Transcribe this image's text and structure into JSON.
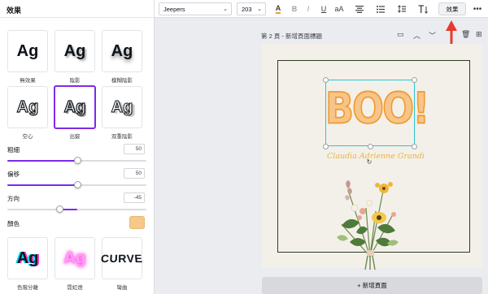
{
  "panel": {
    "title": "效果",
    "effects": [
      {
        "sample": "Ag",
        "label": "無效果"
      },
      {
        "sample": "Ag",
        "label": "陰影"
      },
      {
        "sample": "Ag",
        "label": "模糊陰影"
      },
      {
        "sample": "Ag",
        "label": "空心"
      },
      {
        "sample": "Ag",
        "label": "出竅"
      },
      {
        "sample": "Ag",
        "label": "双重陰影"
      },
      {
        "sample": "Ag",
        "label": "色階分離"
      },
      {
        "sample": "Ag",
        "label": "霓虹燈"
      },
      {
        "sample": "CURVE",
        "label": "彎曲"
      }
    ],
    "selected_effect": "出竅",
    "thickness": {
      "label": "粗細",
      "value": "50",
      "level": 0.5
    },
    "offset": {
      "label": "偏移",
      "value": "50",
      "level": 0.5
    },
    "direction": {
      "label": "方向",
      "value": "-45",
      "level": 0.375
    },
    "color": {
      "label": "顏色",
      "swatch": "#f6c98a"
    }
  },
  "toolbar": {
    "font": "Jeepers",
    "size": "203",
    "text_color_glyph": "A",
    "bold": "B",
    "italic": "I",
    "underline": "U",
    "case": "aA",
    "effects_label": "效果",
    "more": "•••"
  },
  "page": {
    "header": "第 2 頁 - 新增頁面標題",
    "add_page": "+ 新增頁面"
  },
  "canvas": {
    "boo_text": "BOO!",
    "script_text": "Claudia Adrienne Grandi"
  },
  "colors": {
    "accent": "#7d2ae8",
    "selection": "#27c7d2",
    "arrow": "#e53b2c"
  }
}
